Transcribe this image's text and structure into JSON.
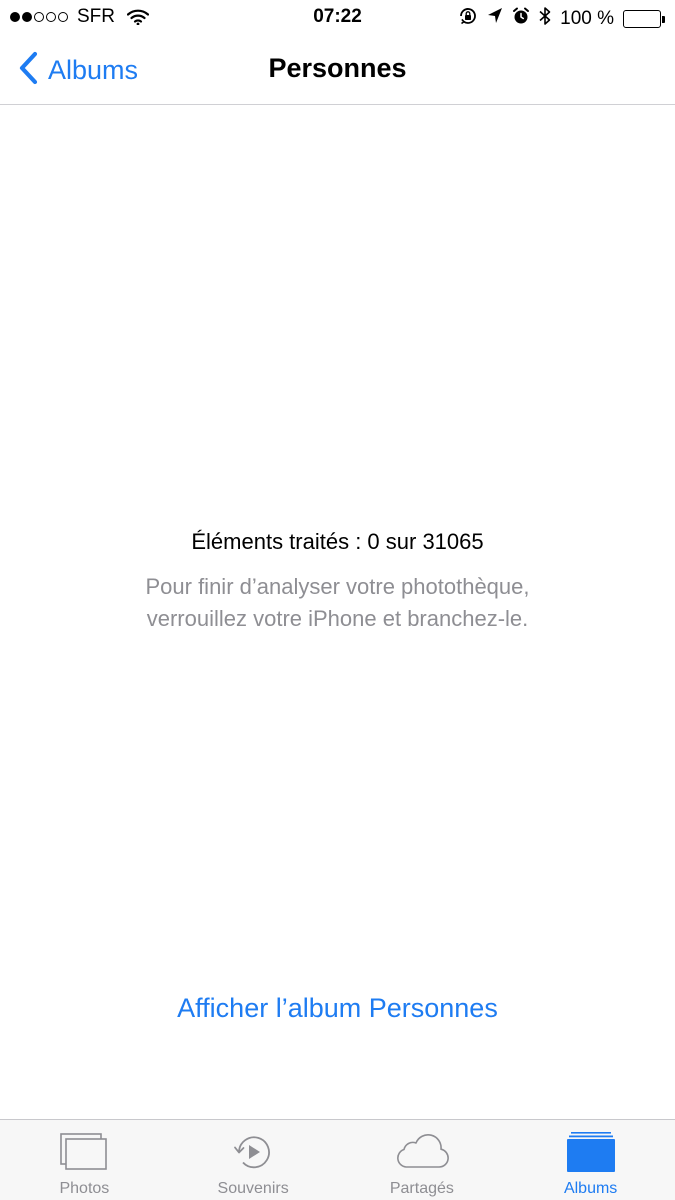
{
  "status_bar": {
    "carrier": "SFR",
    "signal_bars": 2,
    "signal_max": 5,
    "time": "07:22",
    "battery_percent": "100 %",
    "icons": [
      "signal-dots-icon",
      "wifi-icon",
      "rotation-lock-icon",
      "location-icon",
      "alarm-icon",
      "bluetooth-icon",
      "battery-icon"
    ]
  },
  "nav": {
    "back_label": "Albums",
    "title": "Personnes",
    "icons": [
      "chevron-left-icon"
    ]
  },
  "content": {
    "processed_text": "Éléments traités : 0 sur 31065",
    "hint_line1": "Pour finir d’analyser votre photothèque,",
    "hint_line2": "verrouillez votre iPhone et branchez-le.",
    "link_label": "Afficher l’album Personnes"
  },
  "tab_bar": {
    "tabs": [
      {
        "label": "Photos",
        "icon": "photos-icon",
        "active": false
      },
      {
        "label": "Souvenirs",
        "icon": "memories-icon",
        "active": false
      },
      {
        "label": "Partagés",
        "icon": "cloud-icon",
        "active": false
      },
      {
        "label": "Albums",
        "icon": "albums-icon",
        "active": true
      }
    ]
  },
  "colors": {
    "accent": "#1e7cf2",
    "secondary_text": "#8e8e93",
    "tab_bar_bg": "#f7f7f7",
    "divider": "#d0d0d4"
  }
}
